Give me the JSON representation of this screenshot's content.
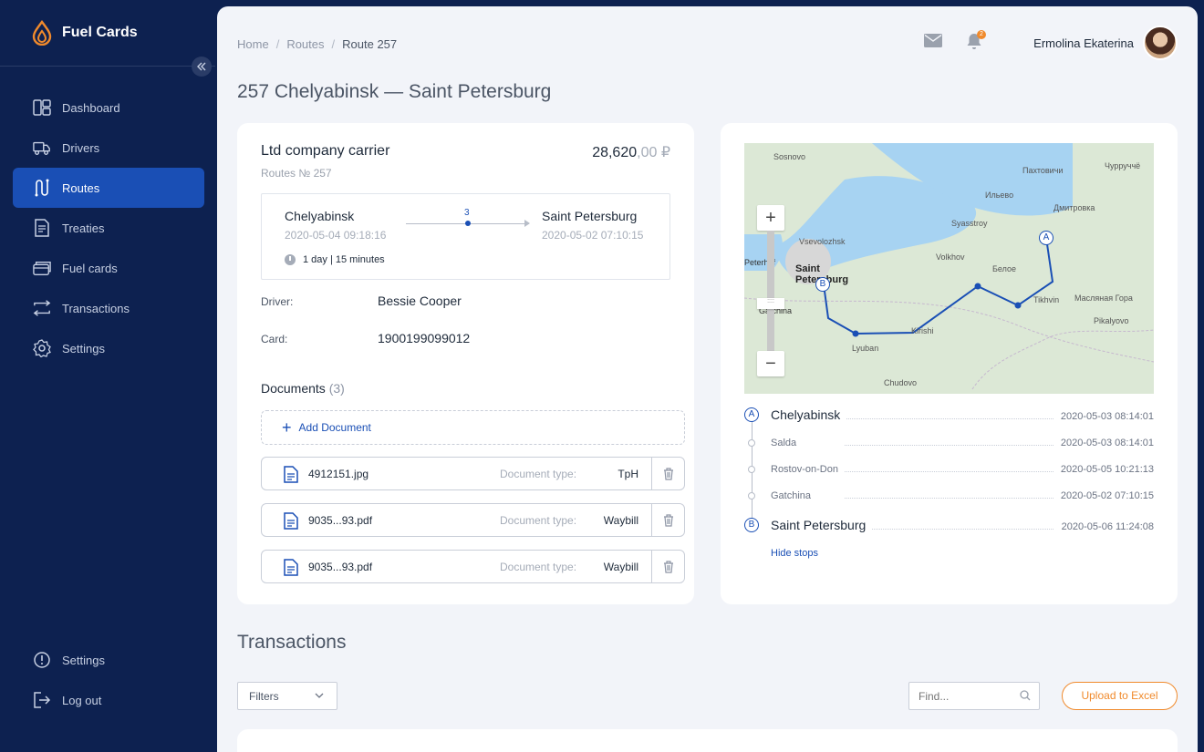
{
  "app": {
    "name": "Fuel Cards",
    "colors": {
      "sidebar": "#0d2150",
      "accent": "#1a4fb5",
      "orange": "#f08a2c",
      "background": "#f2f4f9"
    }
  },
  "sidebar": {
    "items": [
      {
        "label": "Dashboard",
        "icon": "dashboard-icon"
      },
      {
        "label": "Drivers",
        "icon": "truck-icon"
      },
      {
        "label": "Routes",
        "icon": "route-icon",
        "active": true
      },
      {
        "label": "Treaties",
        "icon": "document-icon"
      },
      {
        "label": "Fuel cards",
        "icon": "card-icon"
      },
      {
        "label": "Transactions",
        "icon": "transactions-icon"
      },
      {
        "label": "Settings",
        "icon": "gear-icon"
      }
    ],
    "bottom": [
      {
        "label": "Settings",
        "icon": "info-icon"
      },
      {
        "label": "Log out",
        "icon": "logout-icon"
      }
    ]
  },
  "header": {
    "breadcrumb": [
      "Home",
      "Routes",
      "Route 257"
    ],
    "notifications_count": "2",
    "user_name": "Ermolina Ekaterina"
  },
  "page": {
    "title": "257 Chelyabinsk — Saint Petersburg"
  },
  "route": {
    "carrier": "Ltd company carrier",
    "price_main": "28,620",
    "price_cents": ",00 ₽",
    "number": "Routes № 257",
    "from": "Chelyabinsk",
    "from_date": "2020-05-04 09:18:16",
    "to": "Saint Petersburg",
    "to_date": "2020-05-02 07:10:15",
    "stops_count": "3",
    "duration": "1 day | 15 minutes",
    "driver_label": "Driver:",
    "driver": "Bessie Cooper",
    "card_label": "Card:",
    "card": "1900199099012"
  },
  "documents": {
    "title": "Documents",
    "count": "(3)",
    "add_label": "Add Document",
    "type_label": "Document type:",
    "items": [
      {
        "name": "4912151.jpg",
        "type": "TpH"
      },
      {
        "name": "9035...93.pdf",
        "type": "Waybill"
      },
      {
        "name": "9035...93.pdf",
        "type": "Waybill"
      }
    ]
  },
  "map": {
    "labels": [
      "Sosnovo",
      "Пахтовичи",
      "Чурруччё",
      "Ильево",
      "Дмитровка",
      "Syasstroy",
      "Vsevolozhsk",
      "Volkhov",
      "Белое",
      "Tikhvin",
      "Масляная Гора",
      "Peterhof",
      "Saint Petersburg",
      "Kirishi",
      "Pikalyovo",
      "Gatchina",
      "Lyuban",
      "Chudovo"
    ],
    "marker_a": "A",
    "marker_b": "B",
    "zoom_in": "+",
    "zoom_out": "−"
  },
  "stops": {
    "items": [
      {
        "name": "Chelyabinsk",
        "date": "2020-05-03 08:14:01",
        "marker": "A"
      },
      {
        "name": "Salda",
        "date": "2020-05-03 08:14:01"
      },
      {
        "name": "Rostov-on-Don",
        "date": "2020-05-05 10:21:13"
      },
      {
        "name": "Gatchina",
        "date": "2020-05-02 07:10:15"
      },
      {
        "name": "Saint Petersburg",
        "date": "2020-05-06 11:24:08",
        "marker": "B"
      }
    ],
    "hide_label": "Hide stops"
  },
  "transactions": {
    "title": "Transactions",
    "filters_label": "Filters",
    "find_placeholder": "Find...",
    "upload_label": "Upload to Excel"
  }
}
